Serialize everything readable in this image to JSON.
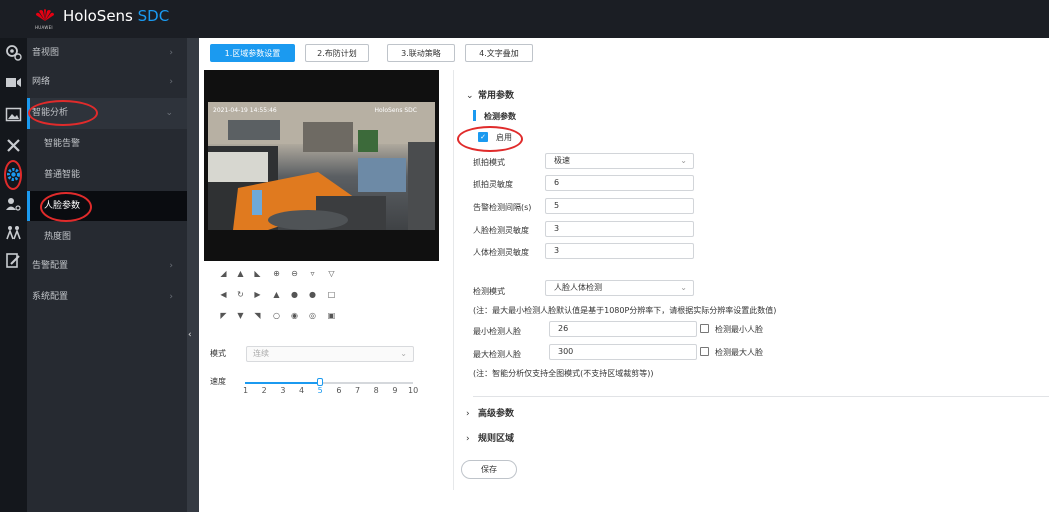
{
  "header": {
    "brand": "HoloSens",
    "brand_suffix": "SDC",
    "logo_text": "HUAWEI",
    "bg_color": "#1b1e24",
    "accent_color": "#1b9af0"
  },
  "rail_icons": [
    "camera-settings-icon",
    "video-icon",
    "image-icon",
    "tools-icon",
    "gear-icon",
    "user-search-icon",
    "people-icon",
    "edit-icon"
  ],
  "sidebar": {
    "items": [
      {
        "label": "音视图"
      },
      {
        "label": "网络"
      },
      {
        "label": "智能分析"
      },
      {
        "label": "告警配置"
      },
      {
        "label": "系统配置"
      }
    ],
    "sub_items": [
      {
        "label": "智能告警"
      },
      {
        "label": "普通智能"
      },
      {
        "label": "人脸参数"
      },
      {
        "label": "热度图"
      }
    ]
  },
  "steps": [
    {
      "label": "1.区域参数设置"
    },
    {
      "label": "2.布防计划"
    },
    {
      "label": "3.联动策略"
    },
    {
      "label": "4.文字叠加"
    }
  ],
  "video": {
    "timestamp": "2021-04-19 14:55:46",
    "osd": "HoloSens SDC"
  },
  "ptz": {
    "mode_label": "模式",
    "mode_value": "连续",
    "speed_label": "速度",
    "speed_ticks": [
      "1",
      "2",
      "3",
      "4",
      "5",
      "6",
      "7",
      "8",
      "9",
      "10"
    ],
    "speed_value": 5,
    "speed_max": 10
  },
  "settings": {
    "common_title": "常用参数",
    "detect_title": "检测参数",
    "enable_label": "启用",
    "enable_checked": true,
    "capture_mode_label": "抓拍模式",
    "capture_mode_value": "极速",
    "capture_sensitivity_label": "抓拍灵敏度",
    "capture_sensitivity_value": "6",
    "alarm_interval_label": "告警检测间隔(s)",
    "alarm_interval_value": "5",
    "face_sensitivity_label": "人脸检测灵敏度",
    "face_sensitivity_value": "3",
    "body_sensitivity_label": "人体检测灵敏度",
    "body_sensitivity_value": "3",
    "detect_mode_label": "检测模式",
    "detect_mode_value": "人脸人体检测",
    "note1": "(注：最大最小检测人脸默认值是基于1080P分辨率下，请根据实际分辨率设置此数值)",
    "min_face_label": "最小检测人脸",
    "min_face_value": "26",
    "min_face_check_label": "检测最小人脸",
    "max_face_label": "最大检测人脸",
    "max_face_value": "300",
    "max_face_check_label": "检测最大人脸",
    "note2": "(注：智能分析仅支持全图模式(不支持区域裁剪等))",
    "advanced_title": "高级参数",
    "rule_area_title": "规则区域",
    "save_label": "保存"
  }
}
